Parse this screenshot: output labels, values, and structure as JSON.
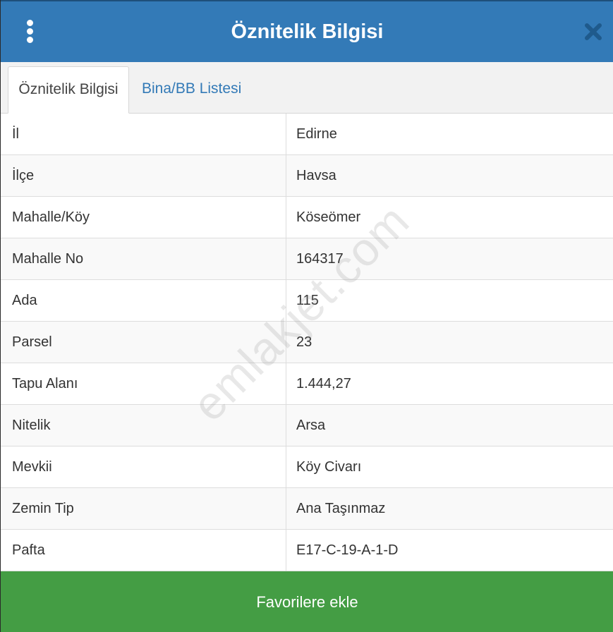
{
  "header": {
    "title": "Öznitelik Bilgisi",
    "menu_icon": "vertical-dots-icon",
    "close_icon": "close-x-icon",
    "background_color": "#337ab7"
  },
  "tabs": [
    {
      "label": "Öznitelik Bilgisi",
      "active": true
    },
    {
      "label": "Bina/BB Listesi",
      "active": false
    }
  ],
  "attributes": [
    {
      "label": "İl",
      "value": "Edirne"
    },
    {
      "label": "İlçe",
      "value": "Havsa"
    },
    {
      "label": "Mahalle/Köy",
      "value": "Köseömer"
    },
    {
      "label": "Mahalle No",
      "value": "164317"
    },
    {
      "label": "Ada",
      "value": "115"
    },
    {
      "label": "Parsel",
      "value": "23"
    },
    {
      "label": "Tapu Alanı",
      "value": "1.444,27"
    },
    {
      "label": "Nitelik",
      "value": "Arsa"
    },
    {
      "label": "Mevkii",
      "value": "Köy Civarı"
    },
    {
      "label": "Zemin Tip",
      "value": "Ana Taşınmaz"
    },
    {
      "label": "Pafta",
      "value": "E17-C-19-A-1-D"
    }
  ],
  "footer": {
    "button_label": "Favorilere ekle",
    "button_color": "#449d44"
  },
  "watermark": "emlakjet.com"
}
